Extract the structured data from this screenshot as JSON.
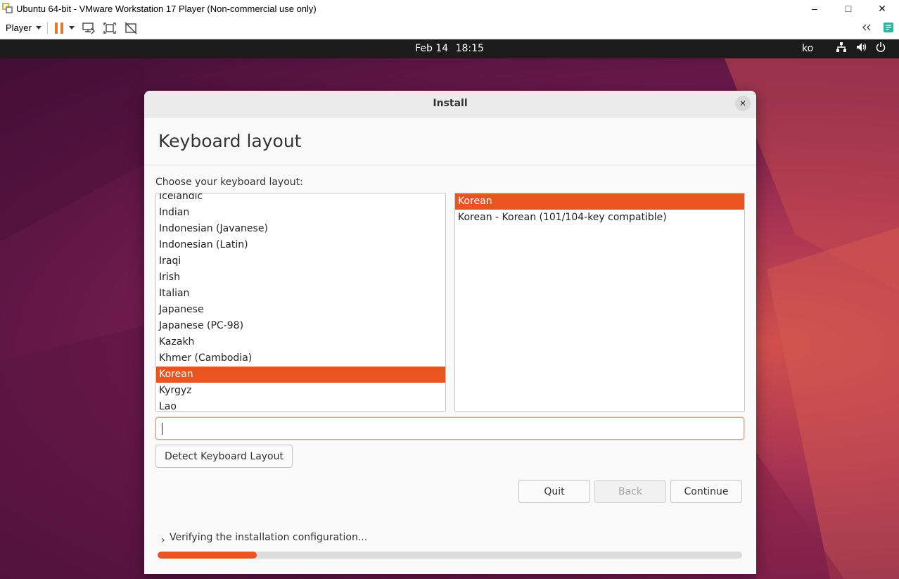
{
  "vm": {
    "window_title": "Ubuntu 64-bit - VMware Workstation 17 Player (Non-commercial use only)",
    "player_menu": "Player",
    "controls": {
      "minimize": "–",
      "maximize": "□",
      "close": "✕"
    }
  },
  "topbar": {
    "date": "Feb 14",
    "time": "18:15",
    "input_lang": "ko"
  },
  "installer": {
    "window_title": "Install",
    "close_glyph": "✕",
    "page_title": "Keyboard layout",
    "prompt": "Choose your keyboard layout:",
    "layouts": [
      "Icelandic",
      "Indian",
      "Indonesian (Javanese)",
      "Indonesian (Latin)",
      "Iraqi",
      "Irish",
      "Italian",
      "Japanese",
      "Japanese (PC-98)",
      "Kazakh",
      "Khmer (Cambodia)",
      "Korean",
      "Kyrgyz",
      "Lao"
    ],
    "selected_layout": "Korean",
    "variants": [
      "Korean",
      "Korean - Korean (101/104-key compatible)"
    ],
    "selected_variant": "Korean",
    "test_input_value": "",
    "detect_button": "Detect Keyboard Layout",
    "quit_button": "Quit",
    "back_button": "Back",
    "continue_button": "Continue",
    "status_chevron": "›",
    "status_text": "Verifying the installation configuration...",
    "progress_fraction": 0.17
  },
  "colors": {
    "accent": "#E95420",
    "topbar": "#1B1B1B"
  }
}
